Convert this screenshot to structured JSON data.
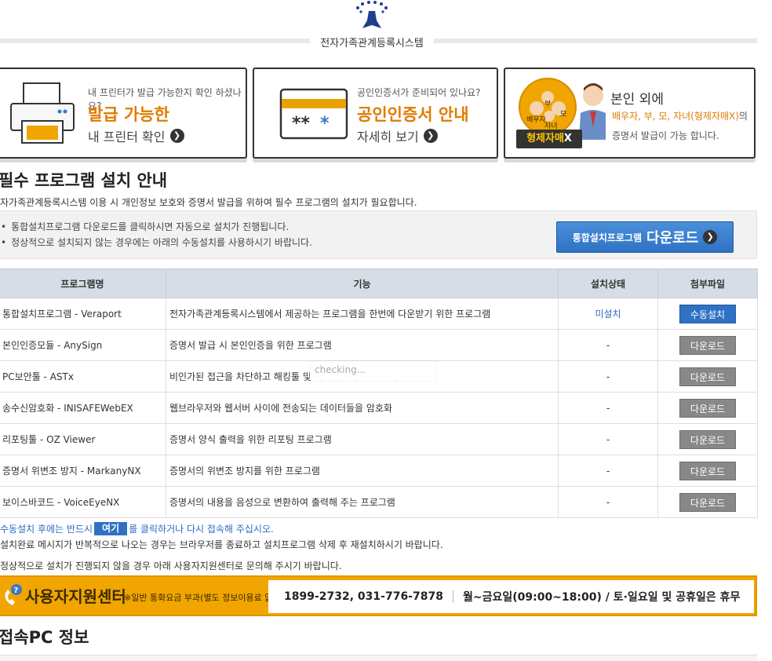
{
  "header": {
    "site_title": "전자가족관계등록시스템"
  },
  "banners": [
    {
      "small": "내 프린터가 발급 가능한지 확인 하셨나요?",
      "big": "발급 가능한",
      "link": "내 프린터 확인"
    },
    {
      "small": "공인인증서가 준비되어 있나요?",
      "big": "공인인증서 안내",
      "link": "자세히 보기"
    },
    {
      "title": "본인 외에",
      "highlight": "배우자, 부, 모, 자녀(형제자매X)",
      "highlight_suffix": "의",
      "line3": "증명서 발급이 가능 합니다.",
      "badge": "형제자매",
      "badge_mark": "X",
      "circle_labels": [
        "부",
        "모",
        "배우자",
        "자녀"
      ]
    }
  ],
  "section": {
    "title": "필수 프로그램 설치 안내",
    "desc": "자가족관계등록시스템 이용 시 개인정보 보호와 증명서 발급을 위하여 필수 프로그램의 설치가 필요합니다."
  },
  "notice": {
    "items": [
      "통합설치프로그램 다운로드를 클릭하시면 자동으로 설치가 진행됩니다.",
      "정상적으로 설치되지 않는 경우에는 아래의 수동설치를 사용하시기 바랍니다."
    ],
    "download_small": "통합설치프로그램",
    "download_big": "다운로드"
  },
  "table": {
    "headers": [
      "프로그램명",
      "기능",
      "설치상태",
      "첨부파일"
    ],
    "rows": [
      {
        "name": "통합설치프로그램 - Veraport",
        "func": "전자가족관계등록시스템에서 제공하는 프로그램을 한번에 다운받기 위한 프로그램",
        "status": "미설치",
        "action": "수동설치"
      },
      {
        "name": "본인인증모듈 - AnySign",
        "func": "증명서 발급 시 본인인증을 위한 프로그램",
        "status": "-",
        "action": "다운로드"
      },
      {
        "name": "PC보안툴 - ASTx",
        "func": "비인가된 접근을 차단하고 해킹툴 및 바이러스의 접근을 차단",
        "status": "-",
        "action": "다운로드"
      },
      {
        "name": "송수신암호화 - INISAFEWebEX",
        "func": "웹브라우저와 웹서버 사이에 전송되는 데이터들을 암호화",
        "status": "-",
        "action": "다운로드"
      },
      {
        "name": "리포팅툴 - OZ Viewer",
        "func": "증명서 양식 출력을 위한 리포팅 프로그램",
        "status": "-",
        "action": "다운로드"
      },
      {
        "name": "증명서 위변조 방지 - MarkanyNX",
        "func": "증명서의 위변조 방지를 위한 프로그램",
        "status": "-",
        "action": "다운로드"
      },
      {
        "name": "보이스바코드 - VoiceEyeNX",
        "func": "증명서의 내용을 음성으로 변환하여 출력해 주는 프로그램",
        "status": "-",
        "action": "다운로드"
      }
    ]
  },
  "tooltip": "checking...",
  "notes": {
    "n1_pre": "수동설치 후에는 반드시",
    "n1_here": "여기",
    "n1_post": "를 클릭하거나 다시 접속해 주십시오.",
    "n2": "설치완료 메시지가 반복적으로 나오는 경우는 브라우저를 종료하고 설치프로그램 삭제 후 재설치하시기 바랍니다.",
    "n3": "정상적으로 설치가 진행되지 않을 경우 아래 사용자지원센터로 문의해 주시기 바랍니다."
  },
  "support": {
    "label": "사용자지원센터",
    "sub": "※일반 통화요금 부과(별도 정보이용료 없음)",
    "phone": "1899-2732, 031-776-7878",
    "hours": "월~금요일(09:00~18:00) / 토·일요일 및 공휴일은 휴무"
  },
  "section2": {
    "title": "접속PC 정보"
  }
}
